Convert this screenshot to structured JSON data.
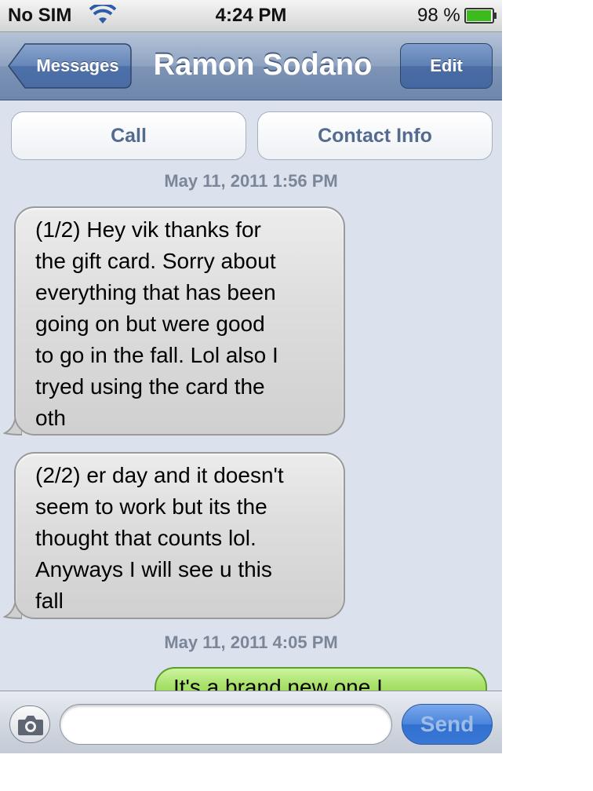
{
  "status_bar": {
    "carrier": "No SIM",
    "time": "4:24 PM",
    "battery_percent": "98 %",
    "battery_level": 0.98,
    "icons": [
      "wifi-icon",
      "battery-icon"
    ]
  },
  "nav": {
    "back_label": "Messages",
    "title": "Ramon Sodano",
    "edit_label": "Edit"
  },
  "actions": {
    "call_label": "Call",
    "contact_info_label": "Contact Info"
  },
  "conversation": {
    "timestamps": [
      "May 11, 2011 1:56 PM",
      "May 11, 2011 4:05 PM"
    ],
    "messages": [
      {
        "direction": "incoming",
        "text": "(1/2) Hey vik thanks for\nthe gift card.  Sorry about\neverything that has been\ngoing on but were good\nto go in the fall.  Lol also I\ntryed using the card the\noth"
      },
      {
        "direction": "incoming",
        "text": "(2/2) er day and it doesn't\nseem to work but its the\nthought that counts lol.\nAnyways I will see u this\nfall"
      },
      {
        "direction": "outgoing",
        "text": "It's a brand new one I"
      }
    ]
  },
  "input_bar": {
    "message_value": "",
    "send_label": "Send",
    "icons": [
      "camera-icon"
    ]
  },
  "colors": {
    "nav_bar": "#7d94b6",
    "background": "#dbe2ed",
    "incoming_bubble": "#d8d8d8",
    "outgoing_bubble": "#a7e067",
    "send_button": "#4a84db"
  }
}
